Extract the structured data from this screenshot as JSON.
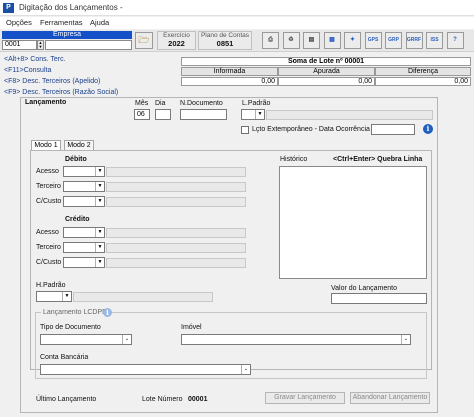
{
  "window": {
    "title": "Digitação dos Lançamentos -"
  },
  "menu": {
    "items": [
      "Opções",
      "Ferramentas",
      "Ajuda"
    ]
  },
  "toolbar": {
    "empresa_label": "Empresa",
    "empresa_code": "0001",
    "exercicio_label": "Exercício",
    "exercicio_value": "2022",
    "plano_label": "Plano de Contas",
    "plano_value": "0851",
    "icon_buttons": [
      {
        "name": "print-icon",
        "glyph": "⎙",
        "color": "#555555"
      },
      {
        "name": "recycle-icon",
        "glyph": "♻",
        "color": "#555555"
      },
      {
        "name": "document-icon",
        "glyph": "▤",
        "color": "#444444"
      },
      {
        "name": "report-icon",
        "glyph": "▦",
        "color": "#2b5fbf"
      },
      {
        "name": "settings-icon",
        "glyph": "✦",
        "color": "#2b5fbf"
      },
      {
        "name": "gps-icon",
        "glyph": "GPS",
        "color": "#2b5fbf"
      },
      {
        "name": "grp-icon",
        "glyph": "GRP",
        "color": "#2b5fbf"
      },
      {
        "name": "grrf-icon",
        "glyph": "GRRF",
        "color": "#2b5fbf"
      },
      {
        "name": "dctf-iss-icon",
        "glyph": "ISS",
        "color": "#2b5fbf"
      },
      {
        "name": "help-icon",
        "glyph": "?",
        "color": "#2b5fbf"
      }
    ]
  },
  "shortcuts": [
    "<Alt+8> Cons. Terc.",
    "<F11>Consulta",
    "<F8> Desc. Terceiros (Apelido)",
    "<F9> Desc. Terceiros (Razão Social)"
  ],
  "soma": {
    "title": "Soma de Lote nº 00001",
    "columns": [
      "Informada",
      "Apurada",
      "Diferença"
    ],
    "values": [
      "0,00",
      "0,00",
      "0,00"
    ]
  },
  "lancamento": {
    "section_label": "Lançamento",
    "mes_label": "Mês",
    "mes_value": "06",
    "dia_label": "Dia",
    "ndoc_label": "N.Documento",
    "lpadrao_label": "L.Padrão",
    "extemporaneo_label": "Lçto Extemporâneo - Data Ocorrência"
  },
  "tabs": [
    "Modo 1",
    "Modo 2"
  ],
  "debito": {
    "label": "Débito",
    "fields": [
      "Acesso",
      "Terceiro",
      "C/Custo"
    ]
  },
  "credito": {
    "label": "Crédito",
    "fields": [
      "Acesso",
      "Terceiro",
      "C/Custo"
    ]
  },
  "historico": {
    "label": "Histórico",
    "hint": "<Ctrl+Enter> Quebra Linha"
  },
  "hpadrao_label": "H.Padrão",
  "valor_label": "Valor do Lançamento",
  "lcdpr": {
    "label": "Lançamento LCDPR",
    "tipo_doc_label": "Tipo de Documento",
    "imovel_label": "Imóvel",
    "conta_label": "Conta Bancária"
  },
  "footer": {
    "ultimo_label": "Último Lançamento",
    "lote_label": "Lote Número",
    "lote_value": "00001",
    "gravar_label": "Gravar Lançamento",
    "abandonar_label": "Abandonar Lançamento"
  }
}
